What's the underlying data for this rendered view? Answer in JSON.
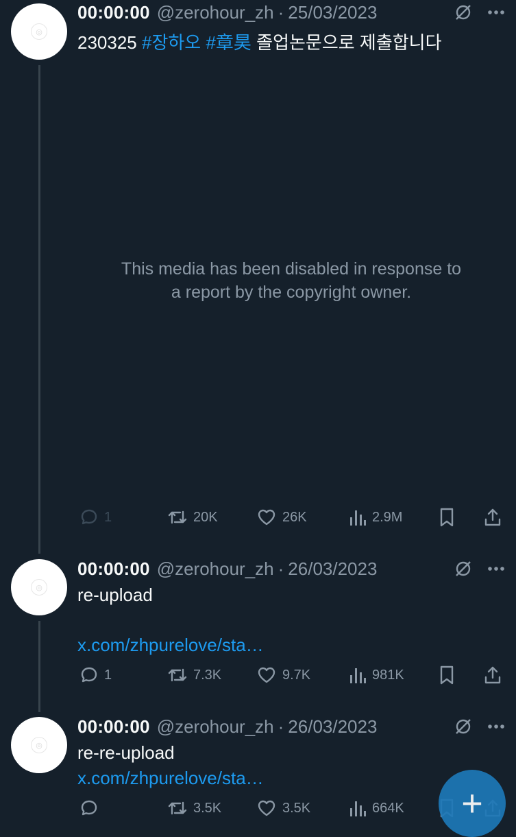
{
  "tweets": [
    {
      "display_name": "00:00:00",
      "handle": "@zerohour_zh",
      "separator": "·",
      "date": "25/03/2023",
      "text_prefix": "230325",
      "hashtag_1": "#장하오",
      "hashtag_2": "#章昊",
      "text_suffix": "졸업논문으로 제출합니다",
      "media_notice_line1": "This media has been disabled in response to",
      "media_notice_line2": "a report by the copyright owner.",
      "stats": {
        "replies": "1",
        "reposts": "20K",
        "likes": "26K",
        "views": "2.9M"
      }
    },
    {
      "display_name": "00:00:00",
      "handle": "@zerohour_zh",
      "separator": "·",
      "date": "26/03/2023",
      "text": "re-upload",
      "link": "x.com/zhpurelove/sta…",
      "stats": {
        "replies": "1",
        "reposts": "7.3K",
        "likes": "9.7K",
        "views": "981K"
      }
    },
    {
      "display_name": "00:00:00",
      "handle": "@zerohour_zh",
      "separator": "·",
      "date": "26/03/2023",
      "text": "re-re-upload",
      "link": "x.com/zhpurelove/sta…",
      "stats": {
        "replies": "",
        "reposts": "3.5K",
        "likes": "3.5K",
        "views": "664K"
      }
    }
  ],
  "fab": {
    "label": "+"
  },
  "colors": {
    "background": "#15202b",
    "accent": "#1d9bf0",
    "muted": "#8b98a5",
    "thread_line": "#38444d"
  },
  "icons": [
    "grok-icon",
    "more-icon",
    "reply-icon",
    "repost-icon",
    "like-icon",
    "views-icon",
    "bookmark-icon",
    "share-icon",
    "compose-icon"
  ]
}
